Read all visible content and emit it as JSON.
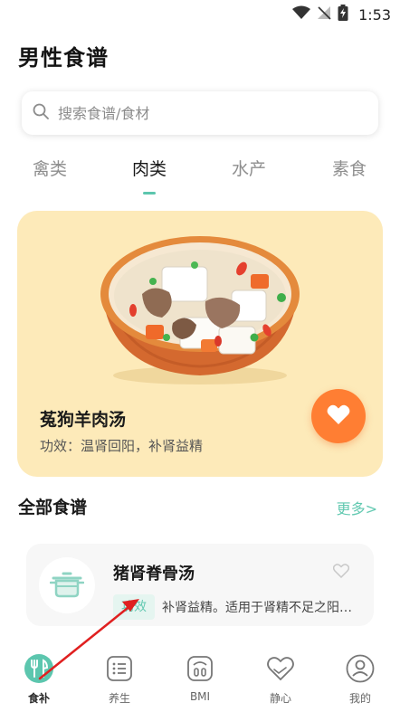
{
  "status_bar": {
    "time": "1:53"
  },
  "header": {
    "title": "男性食谱"
  },
  "search": {
    "placeholder": "搜索食谱/食材"
  },
  "tabs": [
    {
      "label": "禽类",
      "active": false
    },
    {
      "label": "肉类",
      "active": true
    },
    {
      "label": "水产",
      "active": false
    },
    {
      "label": "素食",
      "active": false
    }
  ],
  "featured": {
    "name": "菟狗羊肉汤",
    "effect": "功效：温肾回阳，补肾益精"
  },
  "section": {
    "title": "全部食谱",
    "more": "更多>"
  },
  "recipes": [
    {
      "name": "猪肾脊骨汤",
      "tag": "功效",
      "description": "补肾益精。适用于肾精不足之阳痿..."
    }
  ],
  "bottom_nav": [
    {
      "label": "食补",
      "icon": "food-tonic-icon",
      "active": true
    },
    {
      "label": "养生",
      "icon": "health-list-icon",
      "active": false
    },
    {
      "label": "BMI",
      "icon": "scale-icon",
      "active": false
    },
    {
      "label": "静心",
      "icon": "heart-hand-icon",
      "active": false
    },
    {
      "label": "我的",
      "icon": "profile-icon",
      "active": false
    }
  ],
  "colors": {
    "accent": "#5cc6ae",
    "featured_bg": "#fdeab9",
    "fav_button": "#ff7e33",
    "annotation_arrow": "#e02020"
  }
}
